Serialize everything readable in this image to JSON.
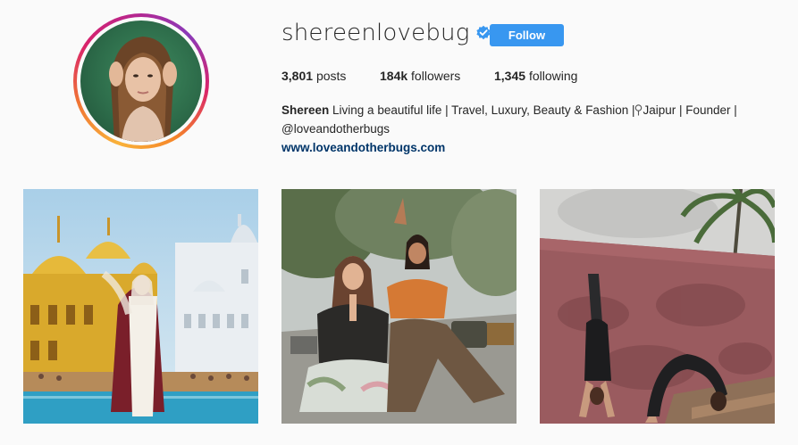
{
  "profile": {
    "username": "shereenlovebug",
    "verified": true,
    "follow_label": "Follow",
    "stats": {
      "posts_count": "3,801",
      "posts_label": "posts",
      "followers_count": "184k",
      "followers_label": "followers",
      "following_count": "1,345",
      "following_label": "following"
    },
    "bio": {
      "name": "Shereen",
      "text": " Living a beautiful life | Travel, Luxury, Beauty & Fashion |",
      "pin_icon": "location-pin-icon",
      "text2": "Jaipur | Founder |",
      "mention": "@loveandotherbugs",
      "website": "www.loveandotherbugs.com"
    }
  },
  "colors": {
    "follow_button": "#3897f0",
    "link": "#003569",
    "verified_badge": "#3897f0",
    "background": "#fafafa"
  },
  "posts": [
    {
      "description_icon": "golden-temple-photo"
    },
    {
      "description_icon": "yoga-pose-street-photo"
    },
    {
      "description_icon": "handstand-wall-photo"
    }
  ]
}
